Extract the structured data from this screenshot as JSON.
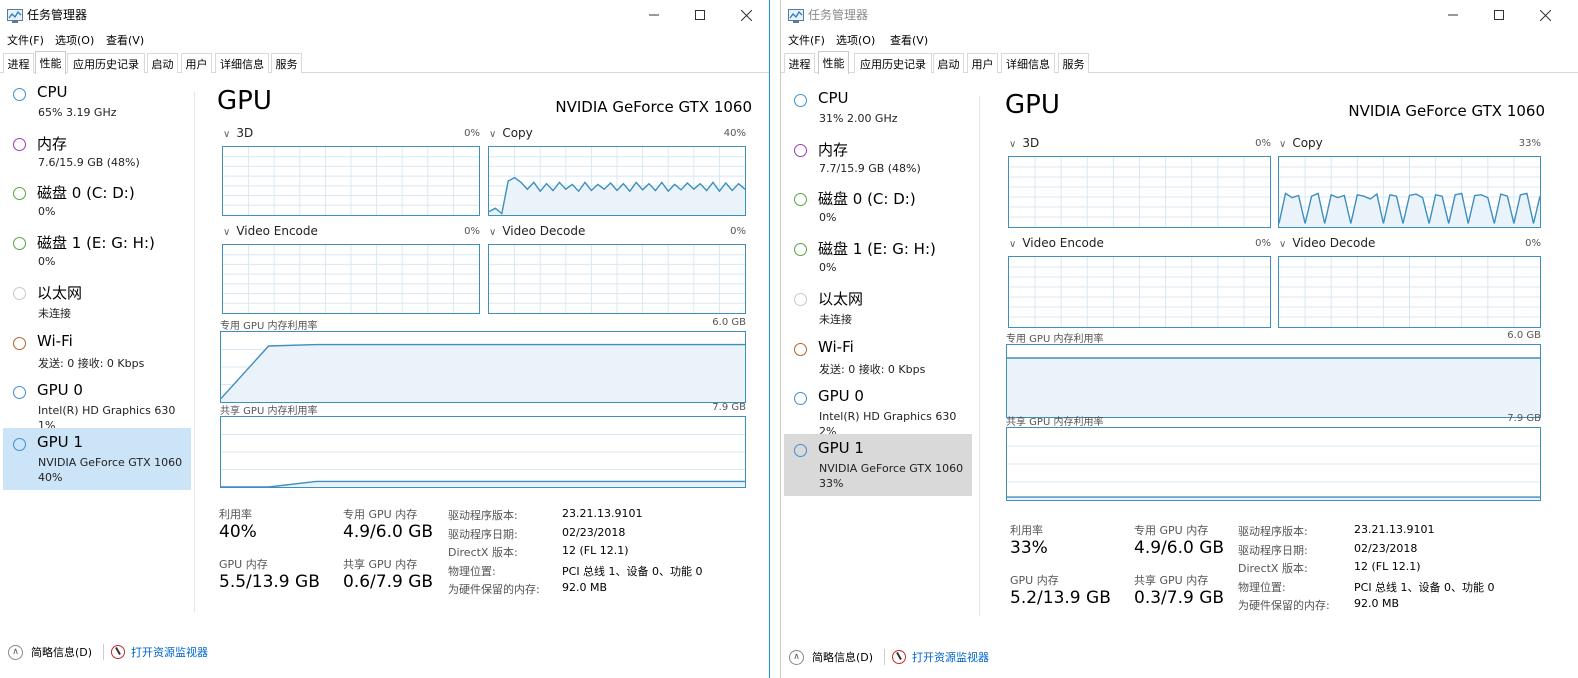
{
  "windows": [
    {
      "id": "left",
      "title": "任务管理器",
      "menu": [
        "文件(F)",
        "选项(O)",
        "查看(V)"
      ],
      "tabs": [
        "进程",
        "性能",
        "应用历史记录",
        "启动",
        "用户",
        "详细信息",
        "服务"
      ],
      "active_tab": "性能",
      "sidebar": [
        {
          "title": "CPU",
          "lines": [
            "65% 3.19 GHz"
          ],
          "color": "#3c8fd6",
          "selected": false
        },
        {
          "title": "内存",
          "lines": [
            "7.6/15.9 GB (48%)"
          ],
          "color": "#9b3cb0",
          "selected": false
        },
        {
          "title": "磁盘 0 (C: D:)",
          "lines": [
            "0%"
          ],
          "color": "#56a642",
          "selected": false
        },
        {
          "title": "磁盘 1 (E: G: H:)",
          "lines": [
            "0%"
          ],
          "color": "#56a642",
          "selected": false
        },
        {
          "title": "以太网",
          "lines": [
            "未连接"
          ],
          "color": "#c8c8c8",
          "selected": false
        },
        {
          "title": "Wi-Fi",
          "lines": [
            "发送: 0 接收: 0 Kbps"
          ],
          "color": "#b5622f",
          "selected": false
        },
        {
          "title": "GPU 0",
          "lines": [
            "Intel(R) HD Graphics 630",
            "1%"
          ],
          "color": "#3c8fd6",
          "selected": false
        },
        {
          "title": "GPU 1",
          "lines": [
            "NVIDIA GeForce GTX 1060",
            "40%"
          ],
          "color": "#3c8fd6",
          "selected": true
        }
      ],
      "main": {
        "heading": "GPU",
        "model": "NVIDIA GeForce GTX 1060",
        "engines": [
          {
            "label": "3D",
            "pct": "0%",
            "history": [
              0,
              0,
              0,
              0,
              0,
              0,
              0,
              0,
              0,
              0,
              0,
              0
            ]
          },
          {
            "label": "Copy",
            "pct": "40%",
            "history": [
              0.05,
              0.1,
              0.02,
              0.5,
              0.55,
              0.48,
              0.38,
              0.48,
              0.35,
              0.46,
              0.36,
              0.48,
              0.38,
              0.45,
              0.35,
              0.48,
              0.36,
              0.45,
              0.38,
              0.47,
              0.36,
              0.46,
              0.35,
              0.48,
              0.37,
              0.46,
              0.36,
              0.48,
              0.35,
              0.45,
              0.37,
              0.47,
              0.38,
              0.46,
              0.36,
              0.48,
              0.35,
              0.47,
              0.36,
              0.46,
              0.38
            ]
          },
          {
            "label": "Video Encode",
            "pct": "0%",
            "history": [
              0,
              0,
              0,
              0,
              0,
              0,
              0,
              0,
              0,
              0,
              0,
              0
            ]
          },
          {
            "label": "Video Decode",
            "pct": "0%",
            "history": [
              0,
              0,
              0,
              0,
              0,
              0,
              0,
              0,
              0,
              0,
              0,
              0
            ]
          }
        ],
        "dedicated": {
          "label": "专用 GPU 内存利用率",
          "max": "6.0 GB",
          "history": [
            0.05,
            0.8,
            0.82,
            0.82,
            0.82,
            0.82,
            0.82,
            0.82,
            0.82,
            0.82,
            0.82,
            0.82
          ]
        },
        "shared": {
          "label": "共享 GPU 内存利用率",
          "max": "7.9 GB",
          "history": [
            0.0,
            0.0,
            0.08,
            0.08,
            0.08,
            0.08,
            0.08,
            0.08,
            0.08,
            0.08,
            0.08,
            0.08
          ]
        },
        "stats": {
          "utilization": {
            "label": "利用率",
            "value": "40%"
          },
          "dedicated_mem": {
            "label": "专用 GPU 内存",
            "value": "4.9/6.0 GB"
          },
          "gpu_mem": {
            "label": "GPU 内存",
            "value": "5.5/13.9 GB"
          },
          "shared_mem": {
            "label": "共享 GPU 内存",
            "value": "0.6/7.9 GB"
          }
        },
        "info": [
          {
            "label": "驱动程序版本:",
            "value": "23.21.13.9101"
          },
          {
            "label": "驱动程序日期:",
            "value": "02/23/2018"
          },
          {
            "label": "DirectX 版本:",
            "value": "12 (FL 12.1)"
          },
          {
            "label": "物理位置:",
            "value": "PCI 总线 1、设备 0、功能 0"
          },
          {
            "label": "为硬件保留的内存:",
            "value": "92.0 MB"
          }
        ]
      },
      "footer": {
        "fewer_details": "简略信息(D)",
        "resource_monitor": "打开资源监视器"
      }
    },
    {
      "id": "right",
      "title": "任务管理器",
      "menu": [
        "文件(F)",
        "选项(O)",
        "查看(V)"
      ],
      "tabs": [
        "进程",
        "性能",
        "应用历史记录",
        "启动",
        "用户",
        "详细信息",
        "服务"
      ],
      "active_tab": "性能",
      "sidebar": [
        {
          "title": "CPU",
          "lines": [
            "31% 2.00 GHz"
          ],
          "color": "#3c8fd6",
          "selected": false
        },
        {
          "title": "内存",
          "lines": [
            "7.7/15.9 GB (48%)"
          ],
          "color": "#9b3cb0",
          "selected": false
        },
        {
          "title": "磁盘 0 (C: D:)",
          "lines": [
            "0%"
          ],
          "color": "#56a642",
          "selected": false
        },
        {
          "title": "磁盘 1 (E: G: H:)",
          "lines": [
            "0%"
          ],
          "color": "#56a642",
          "selected": false
        },
        {
          "title": "以太网",
          "lines": [
            "未连接"
          ],
          "color": "#c8c8c8",
          "selected": false
        },
        {
          "title": "Wi-Fi",
          "lines": [
            "发送: 0 接收: 0 Kbps"
          ],
          "color": "#b5622f",
          "selected": false
        },
        {
          "title": "GPU 0",
          "lines": [
            "Intel(R) HD Graphics 630",
            "2%"
          ],
          "color": "#3c8fd6",
          "selected": false
        },
        {
          "title": "GPU 1",
          "lines": [
            "NVIDIA GeForce GTX 1060",
            "33%"
          ],
          "color": "#3c8fd6",
          "selected": true
        }
      ],
      "main": {
        "heading": "GPU",
        "model": "NVIDIA GeForce GTX 1060",
        "engines": [
          {
            "label": "3D",
            "pct": "0%",
            "history": [
              0,
              0,
              0,
              0,
              0,
              0,
              0,
              0,
              0,
              0,
              0,
              0
            ]
          },
          {
            "label": "Copy",
            "pct": "33%",
            "history": [
              0.05,
              0.48,
              0.42,
              0.45,
              0.05,
              0.44,
              0.48,
              0.05,
              0.46,
              0.42,
              0.45,
              0.05,
              0.46,
              0.44,
              0.4,
              0.47,
              0.05,
              0.46,
              0.44,
              0.05,
              0.45,
              0.47,
              0.42,
              0.05,
              0.46,
              0.44,
              0.05,
              0.46,
              0.48,
              0.05,
              0.45,
              0.46,
              0.42,
              0.05,
              0.47,
              0.44,
              0.05,
              0.46,
              0.48,
              0.05,
              0.44
            ]
          },
          {
            "label": "Video Encode",
            "pct": "0%",
            "history": [
              0,
              0,
              0,
              0,
              0,
              0,
              0,
              0,
              0,
              0,
              0,
              0
            ]
          },
          {
            "label": "Video Decode",
            "pct": "0%",
            "history": [
              0,
              0,
              0,
              0,
              0,
              0,
              0,
              0,
              0,
              0,
              0,
              0
            ]
          }
        ],
        "dedicated": {
          "label": "专用 GPU 内存利用率",
          "max": "6.0 GB",
          "history": [
            0.82,
            0.82,
            0.82,
            0.82,
            0.82,
            0.82,
            0.82,
            0.82,
            0.82,
            0.82,
            0.82,
            0.82
          ]
        },
        "shared": {
          "label": "共享 GPU 内存利用率",
          "max": "7.9 GB",
          "history": [
            0.04,
            0.04,
            0.04,
            0.04,
            0.04,
            0.04,
            0.04,
            0.04,
            0.04,
            0.04,
            0.04,
            0.04
          ]
        },
        "stats": {
          "utilization": {
            "label": "利用率",
            "value": "33%"
          },
          "dedicated_mem": {
            "label": "专用 GPU 内存",
            "value": "4.9/6.0 GB"
          },
          "gpu_mem": {
            "label": "GPU 内存",
            "value": "5.2/13.9 GB"
          },
          "shared_mem": {
            "label": "共享 GPU 内存",
            "value": "0.3/7.9 GB"
          }
        },
        "info": [
          {
            "label": "驱动程序版本:",
            "value": "23.21.13.9101"
          },
          {
            "label": "驱动程序日期:",
            "value": "02/23/2018"
          },
          {
            "label": "DirectX 版本:",
            "value": "12 (FL 12.1)"
          },
          {
            "label": "物理位置:",
            "value": "PCI 总线 1、设备 0、功能 0"
          },
          {
            "label": "为硬件保留的内存:",
            "value": "92.0 MB"
          }
        ]
      },
      "footer": {
        "fewer_details": "简略信息(D)",
        "resource_monitor": "打开资源监视器"
      }
    }
  ],
  "colors": {
    "graph_border": "#3e8ebe",
    "graph_fill": "#eaf3fa",
    "graph_grid": "#d8e8f3",
    "selection_active": "#cce4f7",
    "selection_inactive": "#d9d9d9",
    "link": "#0066cc"
  }
}
